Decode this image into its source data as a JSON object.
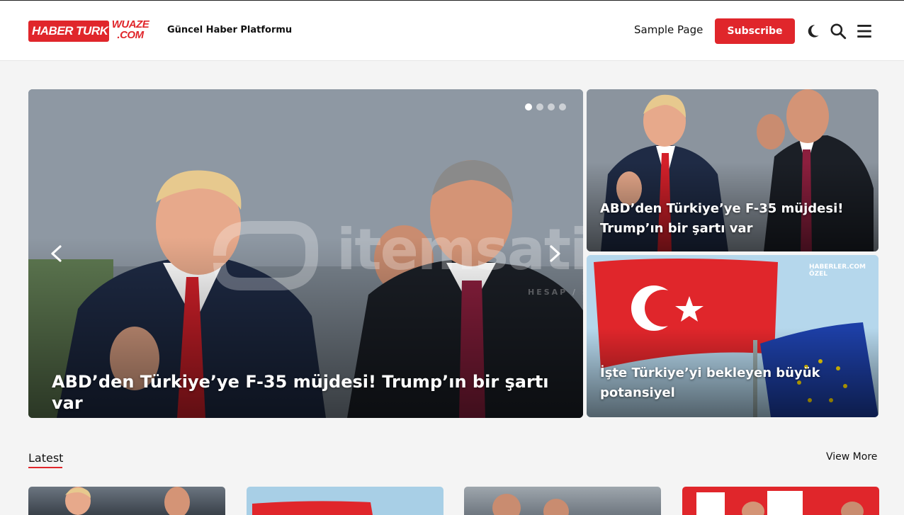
{
  "header": {
    "logo_main": "HABER TURK",
    "logo_sub_line1": "WUAZE",
    "logo_sub_line2": ".COM",
    "tagline": "Güncel Haber Platformu",
    "nav_link": "Sample Page",
    "subscribe_label": "Subscribe",
    "icons": [
      "moon-icon",
      "search-icon",
      "menu-icon"
    ]
  },
  "slider": {
    "title": "ABD’den Türkiye’ye F-35 müjdesi! Trump’ın bir şartı var",
    "slide_count": 4,
    "active_slide": 1
  },
  "watermark": {
    "text": "itemsatis",
    "subtext": "HESAP / SKIN / ITEM / EPIN .com"
  },
  "featured": [
    {
      "title": "ABD’den Türkiye’ye F-35 müjdesi! Trump’ın bir şartı var"
    },
    {
      "title": "İşte Türkiye’yi bekleyen büyük potansiyel",
      "badge_line1": "HABERLER.COM",
      "badge_line2": "ÖZEL"
    }
  ],
  "latest": {
    "heading": "Latest",
    "view_more": "View More"
  },
  "colors": {
    "brand_red": "#e0262b",
    "background": "#f4f4f4",
    "header_bg": "#ffffff"
  }
}
